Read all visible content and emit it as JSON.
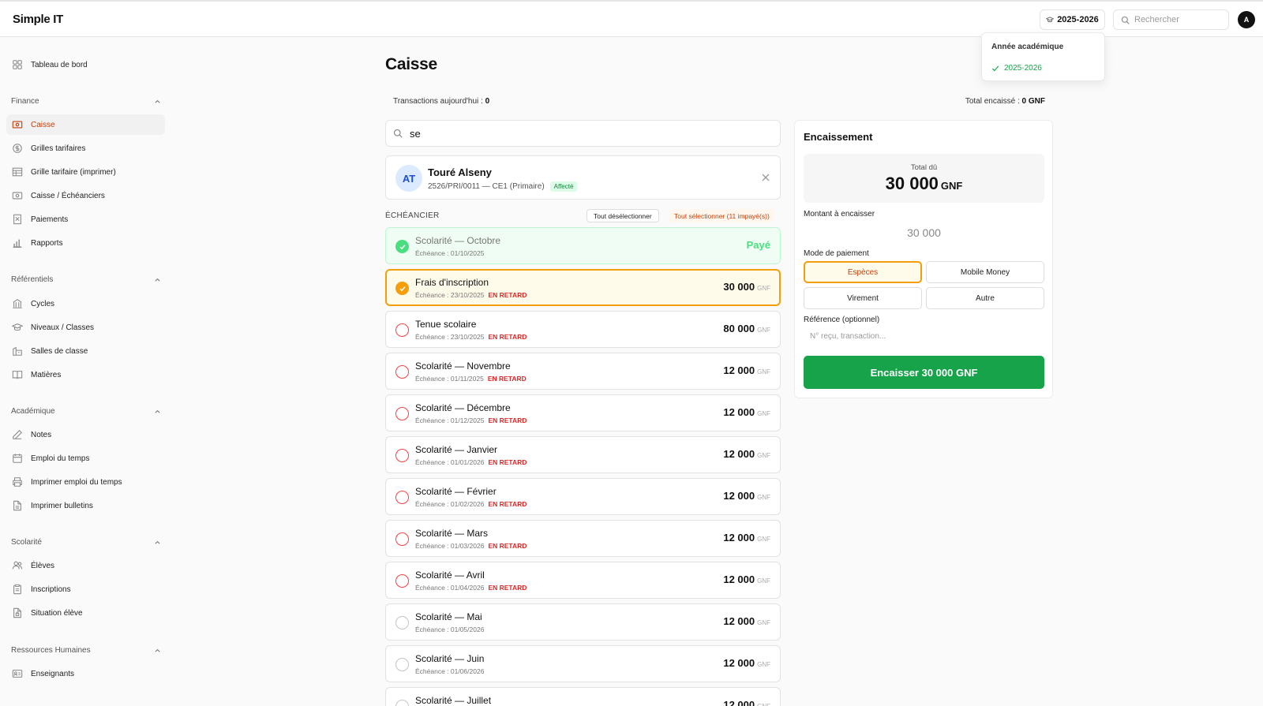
{
  "app": {
    "brand": "Simple IT",
    "year": "2025-2026",
    "search_placeholder": "Rechercher",
    "avatar": "A"
  },
  "year_dropdown": {
    "title": "Année académique",
    "selected": "2025-2026"
  },
  "sidebar": {
    "top": {
      "label": "Tableau de bord",
      "icon": "dashboard-icon"
    },
    "sections": [
      {
        "title": "Finance",
        "items": [
          {
            "label": "Caisse",
            "icon": "cash-register-icon",
            "active": true
          },
          {
            "label": "Grilles tarifaires",
            "icon": "dollar-circle-icon"
          },
          {
            "label": "Grille tarifaire (imprimer)",
            "icon": "table-icon"
          },
          {
            "label": "Caisse / Échéanciers",
            "icon": "banknote-icon"
          },
          {
            "label": "Paiements",
            "icon": "receipt-icon"
          },
          {
            "label": "Rapports",
            "icon": "bar-chart-icon"
          }
        ]
      },
      {
        "title": "Référentiels",
        "items": [
          {
            "label": "Cycles",
            "icon": "building-icon"
          },
          {
            "label": "Niveaux / Classes",
            "icon": "graduation-cap-icon"
          },
          {
            "label": "Salles de classe",
            "icon": "school-icon"
          },
          {
            "label": "Matières",
            "icon": "book-icon"
          }
        ]
      },
      {
        "title": "Académique",
        "items": [
          {
            "label": "Notes",
            "icon": "pencil-icon"
          },
          {
            "label": "Emploi du temps",
            "icon": "calendar-icon"
          },
          {
            "label": "Imprimer emploi du temps",
            "icon": "printer-icon"
          },
          {
            "label": "Imprimer bulletins",
            "icon": "file-icon"
          }
        ]
      },
      {
        "title": "Scolarité",
        "items": [
          {
            "label": "Élèves",
            "icon": "users-icon"
          },
          {
            "label": "Inscriptions",
            "icon": "clipboard-icon"
          },
          {
            "label": "Situation élève",
            "icon": "file-lock-icon"
          }
        ]
      },
      {
        "title": "Ressources Humaines",
        "items": [
          {
            "label": "Enseignants",
            "icon": "id-card-icon"
          }
        ]
      }
    ]
  },
  "main": {
    "title": "Caisse",
    "transactions_label": "Transactions aujourd'hui : ",
    "transactions_value": "0",
    "total_label": "Total encaissé : ",
    "total_value": "0 GNF",
    "search_value": "se",
    "student": {
      "initials": "AT",
      "name": "Touré Alseny",
      "meta": "2526/PRI/0011 — CE1 (Primaire)",
      "badge": "Affecté"
    },
    "schedule_label": "ÉCHÉANCIER",
    "deselect_all": "Tout désélectionner",
    "select_all": "Tout sélectionner (11 impayé(s))",
    "currency": "GNF",
    "late_label": "EN RETARD",
    "paid_label": "Payé",
    "rows": [
      {
        "label": "Scolarité — Octobre",
        "due": "Échéance : 01/10/2025",
        "state": "paid",
        "late": false,
        "amount": ""
      },
      {
        "label": "Frais d'inscription",
        "due": "Échéance : 23/10/2025",
        "state": "selected",
        "late": true,
        "amount": "30 000"
      },
      {
        "label": "Tenue scolaire",
        "due": "Échéance : 23/10/2025",
        "state": "unpaid",
        "late": true,
        "amount": "80 000"
      },
      {
        "label": "Scolarité — Novembre",
        "due": "Échéance : 01/11/2025",
        "state": "unpaid",
        "late": true,
        "amount": "12 000"
      },
      {
        "label": "Scolarité — Décembre",
        "due": "Échéance : 01/12/2025",
        "state": "unpaid",
        "late": true,
        "amount": "12 000"
      },
      {
        "label": "Scolarité — Janvier",
        "due": "Échéance : 01/01/2026",
        "state": "unpaid",
        "late": true,
        "amount": "12 000"
      },
      {
        "label": "Scolarité — Février",
        "due": "Échéance : 01/02/2026",
        "state": "unpaid",
        "late": true,
        "amount": "12 000"
      },
      {
        "label": "Scolarité — Mars",
        "due": "Échéance : 01/03/2026",
        "state": "unpaid",
        "late": true,
        "amount": "12 000"
      },
      {
        "label": "Scolarité — Avril",
        "due": "Échéance : 01/04/2026",
        "state": "unpaid",
        "late": true,
        "amount": "12 000"
      },
      {
        "label": "Scolarité — Mai",
        "due": "Échéance : 01/05/2026",
        "state": "future",
        "late": false,
        "amount": "12 000"
      },
      {
        "label": "Scolarité — Juin",
        "due": "Échéance : 01/06/2026",
        "state": "future",
        "late": false,
        "amount": "12 000"
      },
      {
        "label": "Scolarité — Juillet",
        "due": "",
        "state": "future",
        "late": false,
        "amount": "12 000"
      }
    ]
  },
  "encaissement": {
    "title": "Encaissement",
    "total_label": "Total dû",
    "total_value": "30 000",
    "currency": "GNF",
    "amount_label": "Montant à encaisser",
    "amount_value": "30 000",
    "mode_label": "Mode de paiement",
    "modes": [
      "Espèces",
      "Mobile Money",
      "Virement",
      "Autre"
    ],
    "active_mode": "Espèces",
    "ref_label": "Référence (optionnel)",
    "ref_placeholder": "N° reçu, transaction...",
    "submit": "Encaisser 30 000 GNF"
  },
  "colors": {
    "accent": "#c2410c",
    "selected_border": "#f59e0b",
    "success": "#16a34a",
    "late": "#dc2626"
  }
}
